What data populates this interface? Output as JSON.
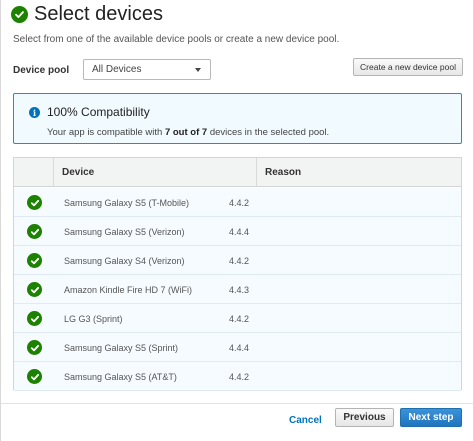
{
  "header": {
    "title": "Select devices",
    "subtitle": "Select from one of the available device pools or create a new device pool."
  },
  "pool": {
    "label": "Device pool",
    "selected": "All Devices",
    "create_button": "Create a new device pool"
  },
  "info": {
    "icon": "info-icon",
    "title": "100% Compatibility",
    "msg_prefix": "Your app is compatible with ",
    "msg_bold": "7 out of 7",
    "msg_suffix": " devices in the selected pool."
  },
  "table": {
    "columns": [
      "",
      "Device",
      "Reason"
    ],
    "rows": [
      {
        "device": "Samsung Galaxy S5 (T-Mobile)",
        "version": "4.4.2",
        "status": "check-icon"
      },
      {
        "device": "Samsung Galaxy S5 (Verizon)",
        "version": "4.4.4",
        "status": "check-icon"
      },
      {
        "device": "Samsung Galaxy S4 (Verizon)",
        "version": "4.4.2",
        "status": "check-icon"
      },
      {
        "device": "Amazon Kindle Fire HD 7 (WiFi)",
        "version": "4.4.3",
        "status": "check-icon"
      },
      {
        "device": "LG G3 (Sprint)",
        "version": "4.4.2",
        "status": "check-icon"
      },
      {
        "device": "Samsung Galaxy S5 (Sprint)",
        "version": "4.4.4",
        "status": "check-icon"
      },
      {
        "device": "Samsung Galaxy S5 (AT&T)",
        "version": "4.4.2",
        "status": "check-icon"
      }
    ]
  },
  "footer": {
    "cancel": "Cancel",
    "previous": "Previous",
    "next": "Next step"
  },
  "colors": {
    "success": "#1d8102",
    "info_border": "#00a1c9",
    "info_bg": "#f1faff",
    "primary": "#1f74be",
    "link": "#0073bb"
  }
}
